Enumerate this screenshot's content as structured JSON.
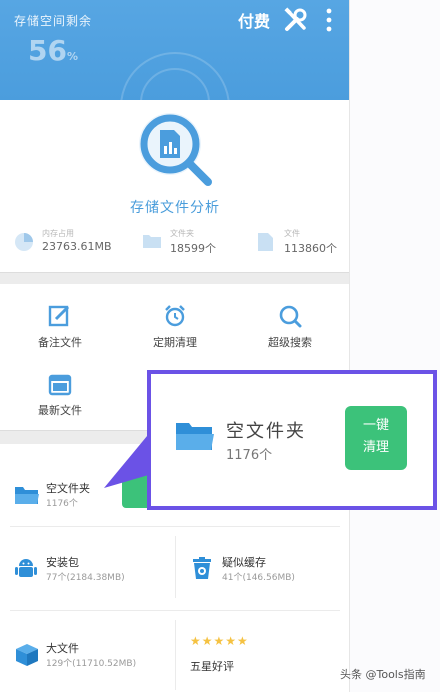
{
  "header": {
    "storage_label": "存储空间剩余",
    "storage_percent": "56",
    "storage_percent_unit": "%",
    "pay_button": "付费",
    "icons": [
      "tools-icon",
      "more-icon"
    ]
  },
  "analysis": {
    "title": "存储文件分析",
    "stats": [
      {
        "label": "内存占用",
        "value": "23763.61MB",
        "icon": "pie-chart-icon"
      },
      {
        "label": "文件夹",
        "value": "18599个",
        "icon": "folder-icon"
      },
      {
        "label": "文件",
        "value": "113860个",
        "icon": "file-icon"
      }
    ]
  },
  "tools": [
    {
      "label": "备注文件",
      "icon": "edit-note-icon"
    },
    {
      "label": "定期清理",
      "icon": "alarm-clock-icon"
    },
    {
      "label": "超级搜索",
      "icon": "search-icon"
    },
    {
      "label": "最新文件",
      "icon": "calendar-new-icon"
    }
  ],
  "clean_items": {
    "empty_folder": {
      "title": "空文件夹",
      "subtitle": "1176个",
      "button_partial": "一键 清理"
    },
    "apk": {
      "title": "安装包",
      "subtitle": "77个(2184.38MB)",
      "icon": "android-icon"
    },
    "suspect_cache": {
      "title": "疑似缓存",
      "subtitle": "41个(146.56MB)",
      "icon": "trash-cache-icon"
    },
    "big_file": {
      "title": "大文件",
      "subtitle": "129个(11710.52MB)",
      "icon": "box-icon"
    },
    "rate": {
      "title": "五星好评",
      "stars": 5,
      "icon": "stars-icon"
    }
  },
  "callout": {
    "title": "空文件夹",
    "subtitle": "1176个",
    "button": "一键\n清理",
    "colors": {
      "border": "#6b52e6",
      "button": "#3cc27a"
    }
  },
  "watermark": "头条 @Tools指南",
  "colors": {
    "accent": "#4b9ddd",
    "green": "#3cc27a",
    "purple": "#6b52e6"
  }
}
